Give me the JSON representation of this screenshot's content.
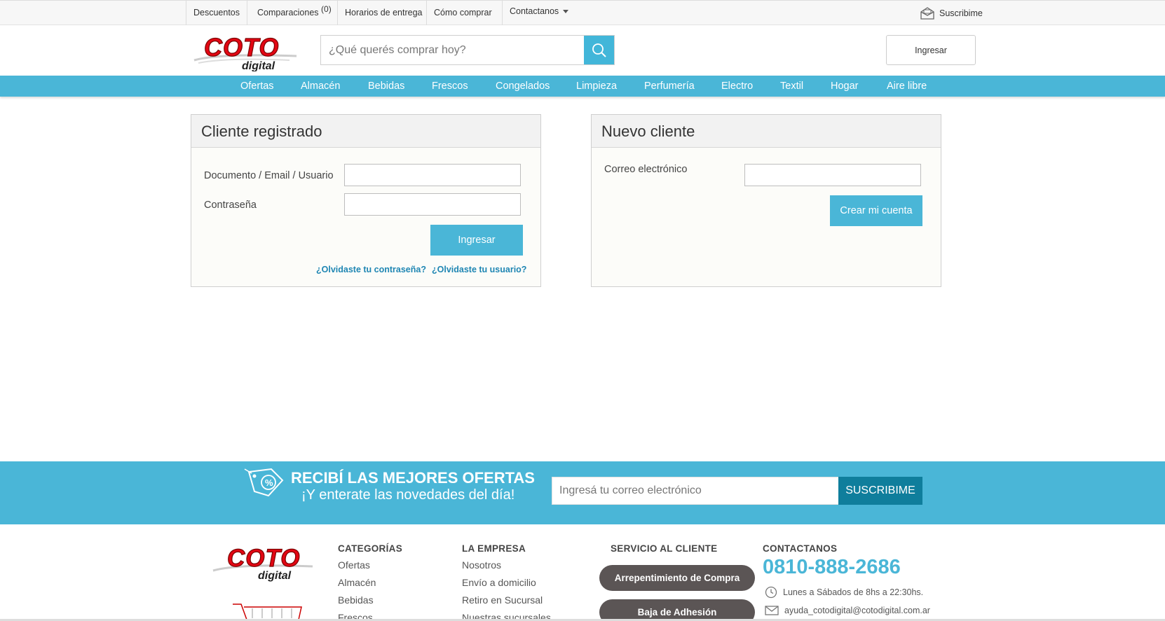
{
  "topbar": {
    "descuentos": "Descuentos",
    "comparaciones": "Comparaciones",
    "comparaciones_count": "(0)",
    "horarios": "Horarios de entrega",
    "como_comprar": "Cómo comprar",
    "contactanos": "Contactanos",
    "suscribime": "Suscribime"
  },
  "header": {
    "logo_main": "COTO",
    "logo_sub": "digital",
    "search_placeholder": "¿Qué querés comprar hoy?",
    "login_button": "Ingresar"
  },
  "categories": [
    "Ofertas",
    "Almacén",
    "Bebidas",
    "Frescos",
    "Congelados",
    "Limpieza",
    "Perfumería",
    "Electro",
    "Textil",
    "Hogar",
    "Aire libre"
  ],
  "registered": {
    "title": "Cliente registrado",
    "user_label": "Documento / Email / Usuario",
    "user_value": "",
    "password_label": "Contraseña",
    "password_value": "",
    "submit": "Ingresar",
    "forgot_password": "¿Olvidaste tu contraseña?",
    "forgot_user": "¿Olvidaste tu usuario?"
  },
  "new_client": {
    "title": "Nuevo cliente",
    "email_label": "Correo electrónico",
    "email_value": "",
    "submit": "Crear mi cuenta"
  },
  "newsletter": {
    "title": "RECIBÍ LAS MEJORES OFERTAS",
    "subtitle": "¡Y enterate las novedades del día!",
    "placeholder": "Ingresá tu correo electrónico",
    "button": "SUSCRIBIME"
  },
  "footer": {
    "categorias": {
      "heading": "CATEGORÍAS",
      "items": [
        "Ofertas",
        "Almacén",
        "Bebidas",
        "Frescos"
      ]
    },
    "empresa": {
      "heading": "LA EMPRESA",
      "items": [
        "Nosotros",
        "Envío a domicilio",
        "Retiro en Sucursal",
        "Nuestras sucursales"
      ]
    },
    "servicio": {
      "heading": "SERVICIO AL CLIENTE",
      "buttons": [
        "Arrepentimiento de Compra",
        "Baja de Adhesión"
      ]
    },
    "contacto": {
      "heading": "CONTACTANOS",
      "phone": "0810-888-2686",
      "hours": "Lunes a Sábados de 8hs a 22:30hs.",
      "email": "ayuda_cotodigital@cotodigital.com.ar"
    }
  },
  "colors": {
    "accent": "#4ab6d7",
    "accent_dark": "#0f7e9c",
    "brand_red": "#e30613",
    "pill": "#5b5555"
  }
}
